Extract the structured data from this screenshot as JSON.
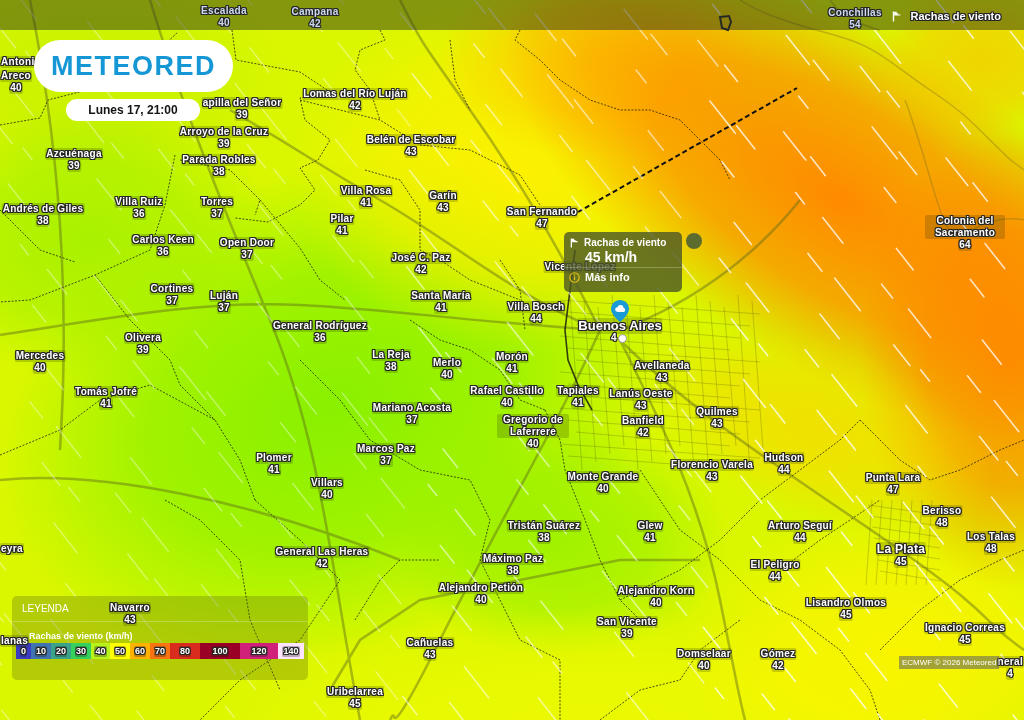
{
  "top_bar": {
    "places": [
      {
        "name": "Escalada",
        "value": "40"
      },
      {
        "name": "Campana",
        "value": "42"
      },
      {
        "name": "Conchillas",
        "value": "54"
      }
    ],
    "layer_title": "Rachas de viento"
  },
  "logo": "METEORED",
  "date": "Lunes 17, 21:00",
  "places": [
    {
      "name": "Antoni"
    },
    {
      "name": "Areco",
      "value": "40"
    },
    {
      "name": "Lomas del Río Luján",
      "value": "42"
    },
    {
      "name": "apilla del Señor",
      "value": "39"
    },
    {
      "name": "Arroyo de la Cruz",
      "value": "39"
    },
    {
      "name": "Belén de Escobar",
      "value": "43"
    },
    {
      "name": "Azcuénaga",
      "value": "39"
    },
    {
      "name": "Parada Robles",
      "value": "38"
    },
    {
      "name": "Villa Rosa",
      "value": "41"
    },
    {
      "name": "Garín",
      "value": "43"
    },
    {
      "name": "Villa Ruiz",
      "value": "36"
    },
    {
      "name": "Torres",
      "value": "37"
    },
    {
      "name": "Andrés de Giles",
      "value": "38"
    },
    {
      "name": "San Fernando",
      "value": "47"
    },
    {
      "name": "Pilar",
      "value": "41"
    },
    {
      "name": "Colonia del Sacramento",
      "value": "64"
    },
    {
      "name": "Carlos Keen",
      "value": "36"
    },
    {
      "name": "Open Door",
      "value": "37"
    },
    {
      "name": "José C. Paz",
      "value": "42"
    },
    {
      "name": "Vicente López"
    },
    {
      "name": "Cortines",
      "value": "37"
    },
    {
      "name": "Luján",
      "value": "37"
    },
    {
      "name": "Santa María",
      "value": "41"
    },
    {
      "name": "Villa Bosch",
      "value": "44"
    },
    {
      "name": "General Rodríguez",
      "value": "36"
    },
    {
      "name": "Olivera",
      "value": "39"
    },
    {
      "name": "Mercedes",
      "value": "40"
    },
    {
      "name": "La Reja",
      "value": "38"
    },
    {
      "name": "Merlo",
      "value": "40"
    },
    {
      "name": "Morón",
      "value": "41"
    },
    {
      "name": "Avellaneda",
      "value": "43"
    },
    {
      "name": "Tomás Jofré",
      "value": "41"
    },
    {
      "name": "Rafael Castillo",
      "value": "40"
    },
    {
      "name": "Tapiales",
      "value": "41"
    },
    {
      "name": "Lanús Oeste",
      "value": "43"
    },
    {
      "name": "Mariano Acosta",
      "value": "37"
    },
    {
      "name": "Quilmes",
      "value": "43"
    },
    {
      "name": "Gregorio de Laferrere",
      "value": "40"
    },
    {
      "name": "Banfield",
      "value": "42"
    },
    {
      "name": "Marcos Paz",
      "value": "37"
    },
    {
      "name": "Plomer",
      "value": "41"
    },
    {
      "name": "Hudson",
      "value": "44"
    },
    {
      "name": "Florencio Varela",
      "value": "43"
    },
    {
      "name": "Villars",
      "value": "40"
    },
    {
      "name": "Monte Grande",
      "value": "40"
    },
    {
      "name": "Punta Lara",
      "value": "47"
    },
    {
      "name": "Berisso",
      "value": "48"
    },
    {
      "name": "Tristán Suárez",
      "value": "38"
    },
    {
      "name": "Glew",
      "value": "41"
    },
    {
      "name": "Arturo Seguí",
      "value": "44"
    },
    {
      "name": "eyra"
    },
    {
      "name": "Los Talas",
      "value": "48"
    },
    {
      "name": "General Las Heras",
      "value": "42"
    },
    {
      "name": "La Plata",
      "value": "45"
    },
    {
      "name": "Máximo Paz",
      "value": "38"
    },
    {
      "name": "El Peligro",
      "value": "44"
    },
    {
      "name": "Alejandro Petión",
      "value": "40"
    },
    {
      "name": "Alejandro Korn",
      "value": "40"
    },
    {
      "name": "Navarro",
      "value": "43"
    },
    {
      "name": "Lisandro Olmos",
      "value": "45"
    },
    {
      "name": "San Vicente",
      "value": "39"
    },
    {
      "name": "lanas"
    },
    {
      "name": "Ignacio Correas",
      "value": "45"
    },
    {
      "name": "Cañuelas",
      "value": "43"
    },
    {
      "name": "Domselaar",
      "value": "40"
    },
    {
      "name": "Gómez",
      "value": "42"
    },
    {
      "name": "neral",
      "value": "4"
    },
    {
      "name": "Uribelarrea",
      "value": "45"
    }
  ],
  "city": {
    "name": "Buenos Aires",
    "value": "4"
  },
  "popup": {
    "title": "Rachas de viento",
    "reading": "45 km/h",
    "link": "Más info"
  },
  "legend": {
    "title": "LEYENDA",
    "scale_title": "Rachas de viento (km/h)",
    "stops": [
      {
        "label": "0",
        "color": "#3b3cc4"
      },
      {
        "label": "10",
        "color": "#3f74b0"
      },
      {
        "label": "20",
        "color": "#3aa38a"
      },
      {
        "label": "30",
        "color": "#36d15c"
      },
      {
        "label": "40",
        "color": "#b8f41c"
      },
      {
        "label": "50",
        "color": "#ffff00"
      },
      {
        "label": "60",
        "color": "#ffb300"
      },
      {
        "label": "70",
        "color": "#f77410"
      },
      {
        "label": "80",
        "color": "#d92b1e"
      },
      {
        "label": "100",
        "color": "#9a0025"
      },
      {
        "label": "120",
        "color": "#d0207a"
      },
      {
        "label": "140",
        "color": "#ffe4ff"
      }
    ]
  },
  "attribution": "ECMWF © 2026 Meteored"
}
